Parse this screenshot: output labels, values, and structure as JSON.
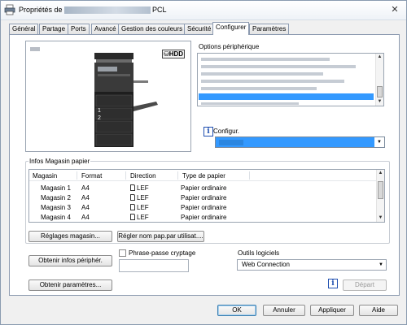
{
  "window": {
    "title_prefix": "Propriétés de",
    "title_suffix": "PCL",
    "close_glyph": "✕"
  },
  "tabs": [
    {
      "label": "Général"
    },
    {
      "label": "Partage"
    },
    {
      "label": "Ports"
    },
    {
      "label": "Avancé"
    },
    {
      "label": "Gestion des couleurs"
    },
    {
      "label": "Sécurité"
    },
    {
      "label": "Configurer",
      "active": true
    },
    {
      "label": "Paramètres"
    }
  ],
  "preview": {
    "hdd_label": "HDD",
    "tray_numbers": [
      "1",
      "2"
    ]
  },
  "options": {
    "label": "Options périphérique",
    "selected_index": 5
  },
  "config": {
    "label": "Configur.",
    "icon": "info-icon"
  },
  "trays": {
    "group_label": "Infos Magasin papier",
    "columns": [
      "Magasin",
      "Format",
      "Direction",
      "Type de papier"
    ],
    "rows": [
      {
        "name": "Magasin 1",
        "format": "A4",
        "direction": "LEF",
        "type": "Papier ordinaire"
      },
      {
        "name": "Magasin 2",
        "format": "A4",
        "direction": "LEF",
        "type": "Papier ordinaire"
      },
      {
        "name": "Magasin 3",
        "format": "A4",
        "direction": "LEF",
        "type": "Papier ordinaire"
      },
      {
        "name": "Magasin 4",
        "format": "A4",
        "direction": "LEF",
        "type": "Papier ordinaire"
      }
    ]
  },
  "buttons": {
    "tray_settings": "Réglages magasin...",
    "paper_name": "Régler nom pap.par utilisat....",
    "get_device_info": "Obtenir infos périphér.",
    "get_settings": "Obtenir paramètres...",
    "start": "Départ",
    "ok": "OK",
    "cancel": "Annuler",
    "apply": "Appliquer",
    "help": "Aide"
  },
  "passphrase": {
    "label": "Phrase-passe cryptage",
    "checked": false,
    "value": ""
  },
  "tools": {
    "label": "Outils logiciels",
    "selected": "Web Connection"
  },
  "colors": {
    "selection": "#3399ff",
    "accent": "#3c7fb1"
  }
}
